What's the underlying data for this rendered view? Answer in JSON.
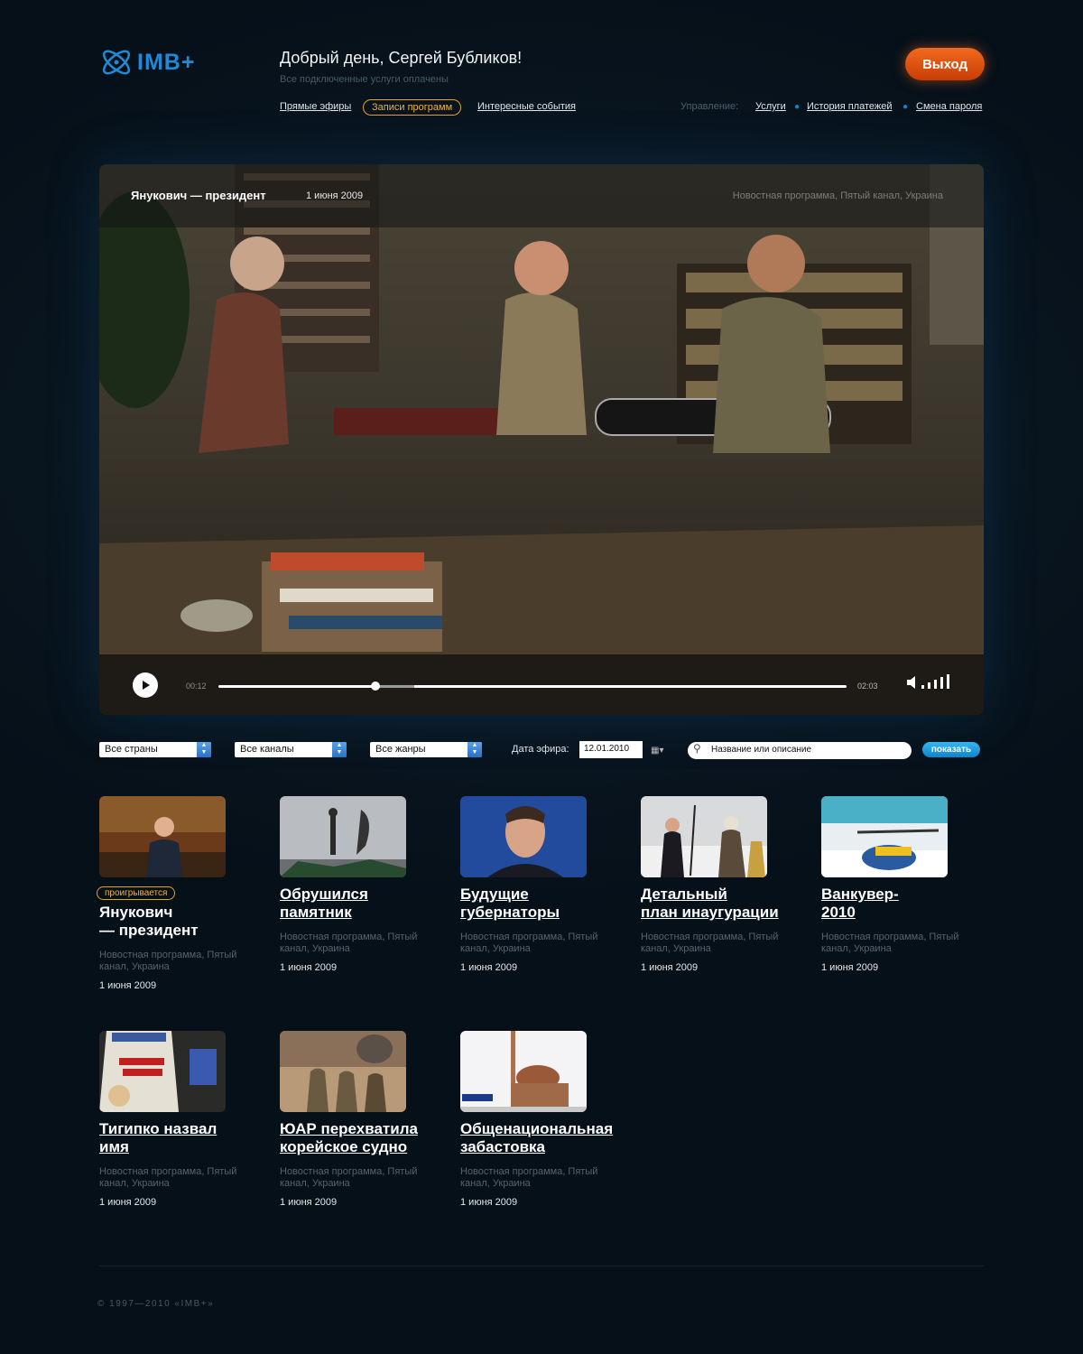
{
  "header": {
    "logo": "IMB+",
    "greeting": "Добрый день, Сергей Бубликов!",
    "subgreeting": "Все подключенные услуги оплачены",
    "logout": "Выход",
    "nav": [
      "Прямые эфиры",
      "Записи программ",
      "Интересные события"
    ],
    "management_label": "Управление:",
    "management_links": [
      "Услуги",
      "История платежей",
      "Смена пароля"
    ]
  },
  "player": {
    "title": "Янукович — президент",
    "date": "1 июня 2009",
    "meta": "Новостная программа, Пятый канал, Украина",
    "time_current": "00:12",
    "time_total": "02:03",
    "progress": 0.25
  },
  "filters": {
    "countries": "Все страны",
    "channels": "Все каналы",
    "genres": "Все жанры",
    "date_label": "Дата эфира:",
    "date_value": "12.01.2010",
    "search_placeholder": "Название или описание",
    "search_button": "показать"
  },
  "items": [
    {
      "title": "Янукович\n— президент",
      "meta": "Новостная программа, Пятый канал, Украина",
      "date": "1 июня 2009",
      "badge": "проигрывается"
    },
    {
      "title": "Обрушился\nпамятник",
      "meta": "Новостная программа, Пятый канал, Украина",
      "date": "1 июня 2009"
    },
    {
      "title": "Будущие\nгубернаторы",
      "meta": "Новостная программа, Пятый канал, Украина",
      "date": "1 июня 2009"
    },
    {
      "title": "Детальный\nплан инаугурации",
      "meta": "Новостная программа, Пятый канал, Украина",
      "date": "1 июня 2009"
    },
    {
      "title": "Ванкувер-\n2010",
      "meta": "Новостная программа, Пятый канал, Украина",
      "date": "1 июня 2009"
    },
    {
      "title": "Тигипко назвал\nимя",
      "meta": "Новостная программа, Пятый канал, Украина",
      "date": "1 июня 2009"
    },
    {
      "title": "ЮАР перехватила\nкорейское судно",
      "meta": "Новостная программа, Пятый канал, Украина",
      "date": "1 июня 2009"
    },
    {
      "title": "Общенациональная\nзабастовка",
      "meta": "Новостная программа, Пятый канал, Украина",
      "date": "1 июня 2009"
    }
  ],
  "footer": {
    "copyright": "© 1997—2010 «IMB+»"
  },
  "colors": {
    "accent_orange": "#e95a14",
    "accent_blue": "#1f8ad6",
    "badge_gold": "#e4a322"
  }
}
